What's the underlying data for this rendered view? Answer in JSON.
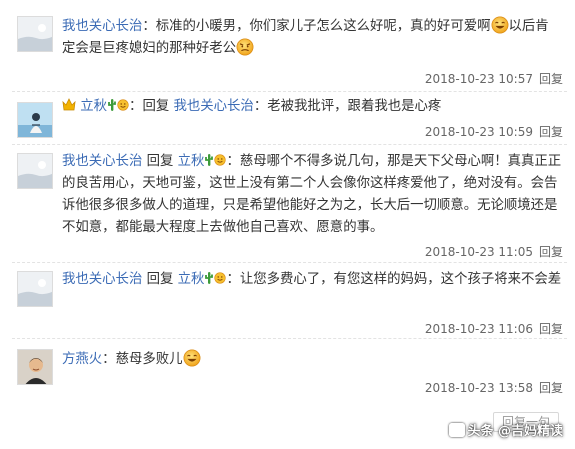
{
  "comments": [
    {
      "user": "我也关心长治",
      "sep": "：",
      "text1": "标准的小暖男，你们家儿子怎么这么好呢，真的好可爱啊",
      "text2": "以后肯定会是巨疼媳妇的那种好老公",
      "date": "2018-10-23 10:57",
      "reply": "回复"
    },
    {
      "user": "立秋",
      "sep": "：",
      "reply_prefix": "回复",
      "reply_to": "我也关心长治",
      "text": "：老被我批评，跟着我也是心疼",
      "date": "2018-10-23 10:59",
      "reply": "回复"
    },
    {
      "user": "我也关心长治",
      "reply_prefix": "回复",
      "reply_to": "立秋",
      "text": "：慈母哪个不得多说几句，那是天下父母心啊！真真正正的良苦用心，天地可鉴，这世上没有第二个人会像你这样疼爱他了，绝对没有。会告诉他很多很多做人的道理，只是希望他能好之为之，长大后一切顺意。无论顺境还是不如意，都能最大程度上去做他自己喜欢、愿意的事。",
      "date": "2018-10-23 11:05",
      "reply": "回复"
    },
    {
      "user": "我也关心长治",
      "reply_prefix": "回复",
      "reply_to": "立秋",
      "text": "：让您多费心了，有您这样的妈妈，这个孩子将来不会差",
      "date": "2018-10-23 11:06",
      "reply": "回复"
    },
    {
      "user": "方燕火",
      "sep": "：",
      "text": "慈母多败儿",
      "date": "2018-10-23 13:58",
      "reply": "回复"
    }
  ],
  "footer": {
    "ghost_reply": "回复一句",
    "watermark": "头条 @吉妈精读"
  },
  "colors": {
    "link": "#3b6bb5",
    "text": "#333333",
    "meta": "#666666"
  }
}
